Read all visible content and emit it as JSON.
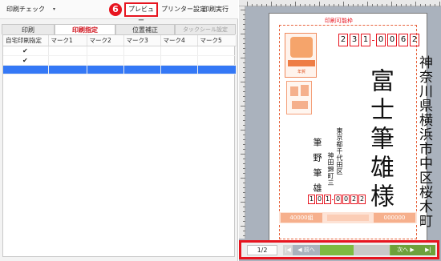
{
  "toolbar": {
    "print_check": "印刷チェック",
    "dropdown_glyph": "▾",
    "step_number": "6",
    "preview": "プレビュー",
    "printer_settings": "プリンター設定",
    "print_run": "印刷実行"
  },
  "tabs": [
    {
      "label": "印刷"
    },
    {
      "label": "印刷指定"
    },
    {
      "label": "位置補正"
    },
    {
      "label": "タックシール設定"
    }
  ],
  "grid": {
    "columns": [
      "自宅印刷指定",
      "マーク1",
      "マーク2",
      "マーク3",
      "マーク4",
      "マーク5"
    ],
    "rows": [
      {
        "check": "✔"
      },
      {
        "check": "✔"
      },
      {
        "check": ""
      }
    ]
  },
  "card": {
    "print_area_label": "印刷可能枠",
    "zip_top": [
      "2",
      "3",
      "1",
      "0",
      "0",
      "6",
      "2"
    ],
    "address_line1": "神奈川県横浜市中区桜木町",
    "address_line2": "",
    "recipient": "富士筆雄様",
    "sender_address": "東京都千代田区",
    "sender_address2": "神田錦町三",
    "sender_name": "筆野筆雄",
    "zip_bottom": [
      "1",
      "0",
      "1",
      "0",
      "0",
      "2",
      "2"
    ],
    "stamp_label": "年賀",
    "strip_left": "40000組",
    "strip_right": "000000"
  },
  "nav": {
    "page": "1/2",
    "first": "|◀",
    "prev_arrow": "◀",
    "prev": "前へ",
    "next": "次へ",
    "next_arrow": "▶",
    "last": "▶|"
  },
  "colors": {
    "accent_red": "#e7141f",
    "selection_blue": "#3478f6",
    "nav_green": "#7dbb40",
    "stamp_orange": "#f08a5d"
  }
}
